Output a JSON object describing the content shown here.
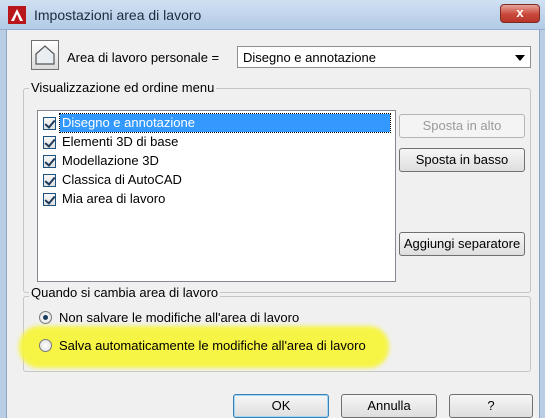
{
  "window": {
    "title": "Impostazioni area di lavoro",
    "close_label": "x"
  },
  "workspace": {
    "label": "Area di lavoro personale =",
    "selected": "Disegno e annotazione"
  },
  "menu_group": {
    "label": "Visualizzazione ed ordine menu",
    "items": [
      {
        "label": "Disegno e annotazione",
        "checked": true,
        "selected": true
      },
      {
        "label": "Elementi 3D di base",
        "checked": true,
        "selected": false
      },
      {
        "label": "Modellazione 3D",
        "checked": true,
        "selected": false
      },
      {
        "label": "Classica di AutoCAD",
        "checked": true,
        "selected": false
      },
      {
        "label": "Mia area di lavoro",
        "checked": true,
        "selected": false
      }
    ],
    "buttons": {
      "move_up": "Sposta in alto",
      "move_down": "Sposta in basso",
      "add_separator": "Aggiungi separatore"
    }
  },
  "change_group": {
    "label": "Quando si cambia area di lavoro",
    "options": [
      {
        "label": "Non salvare le modifiche all'area di lavoro",
        "checked": true
      },
      {
        "label": "Salva automaticamente le modifiche all'area di lavoro",
        "checked": false
      }
    ]
  },
  "footer": {
    "ok": "OK",
    "cancel": "Annulla",
    "help": "?"
  },
  "colors": {
    "highlight": "#f7f53c",
    "selection": "#3399ff",
    "close": "#c9473a"
  }
}
